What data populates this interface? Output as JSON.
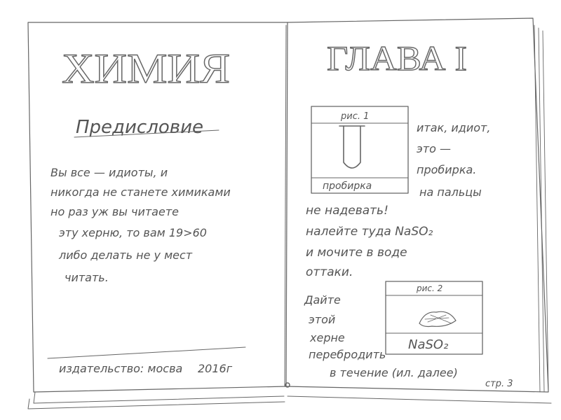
{
  "left_page": {
    "title": "ХИМИЯ",
    "subtitle": "Предисловие",
    "body_lines": [
      "Вы все — идиоты, и",
      "никогда не станете химиками",
      "но раз уж вы читаете",
      "эту херню, то вам 19>60",
      "либо делать не у мест",
      "читать."
    ],
    "publisher": "издательство: мосва",
    "year": "2016г"
  },
  "right_page": {
    "title": "ГЛАВА I",
    "fig1": {
      "label": "рис. 1",
      "caption": "пробирка"
    },
    "side_text": [
      "итак, идиот,",
      "это —",
      "пробирка.",
      "на пальцы"
    ],
    "body_lines": [
      "не надевать!",
      "налейте туда NaSO₂",
      "и мочите в воде",
      "оттаки."
    ],
    "fig2": {
      "label": "рис. 2",
      "caption": "NaSO₂"
    },
    "note_lines": [
      "Дайте",
      "этой",
      "херне",
      "перебродить",
      "в течение (ил. далее)"
    ],
    "page_number": "стр. 3"
  }
}
